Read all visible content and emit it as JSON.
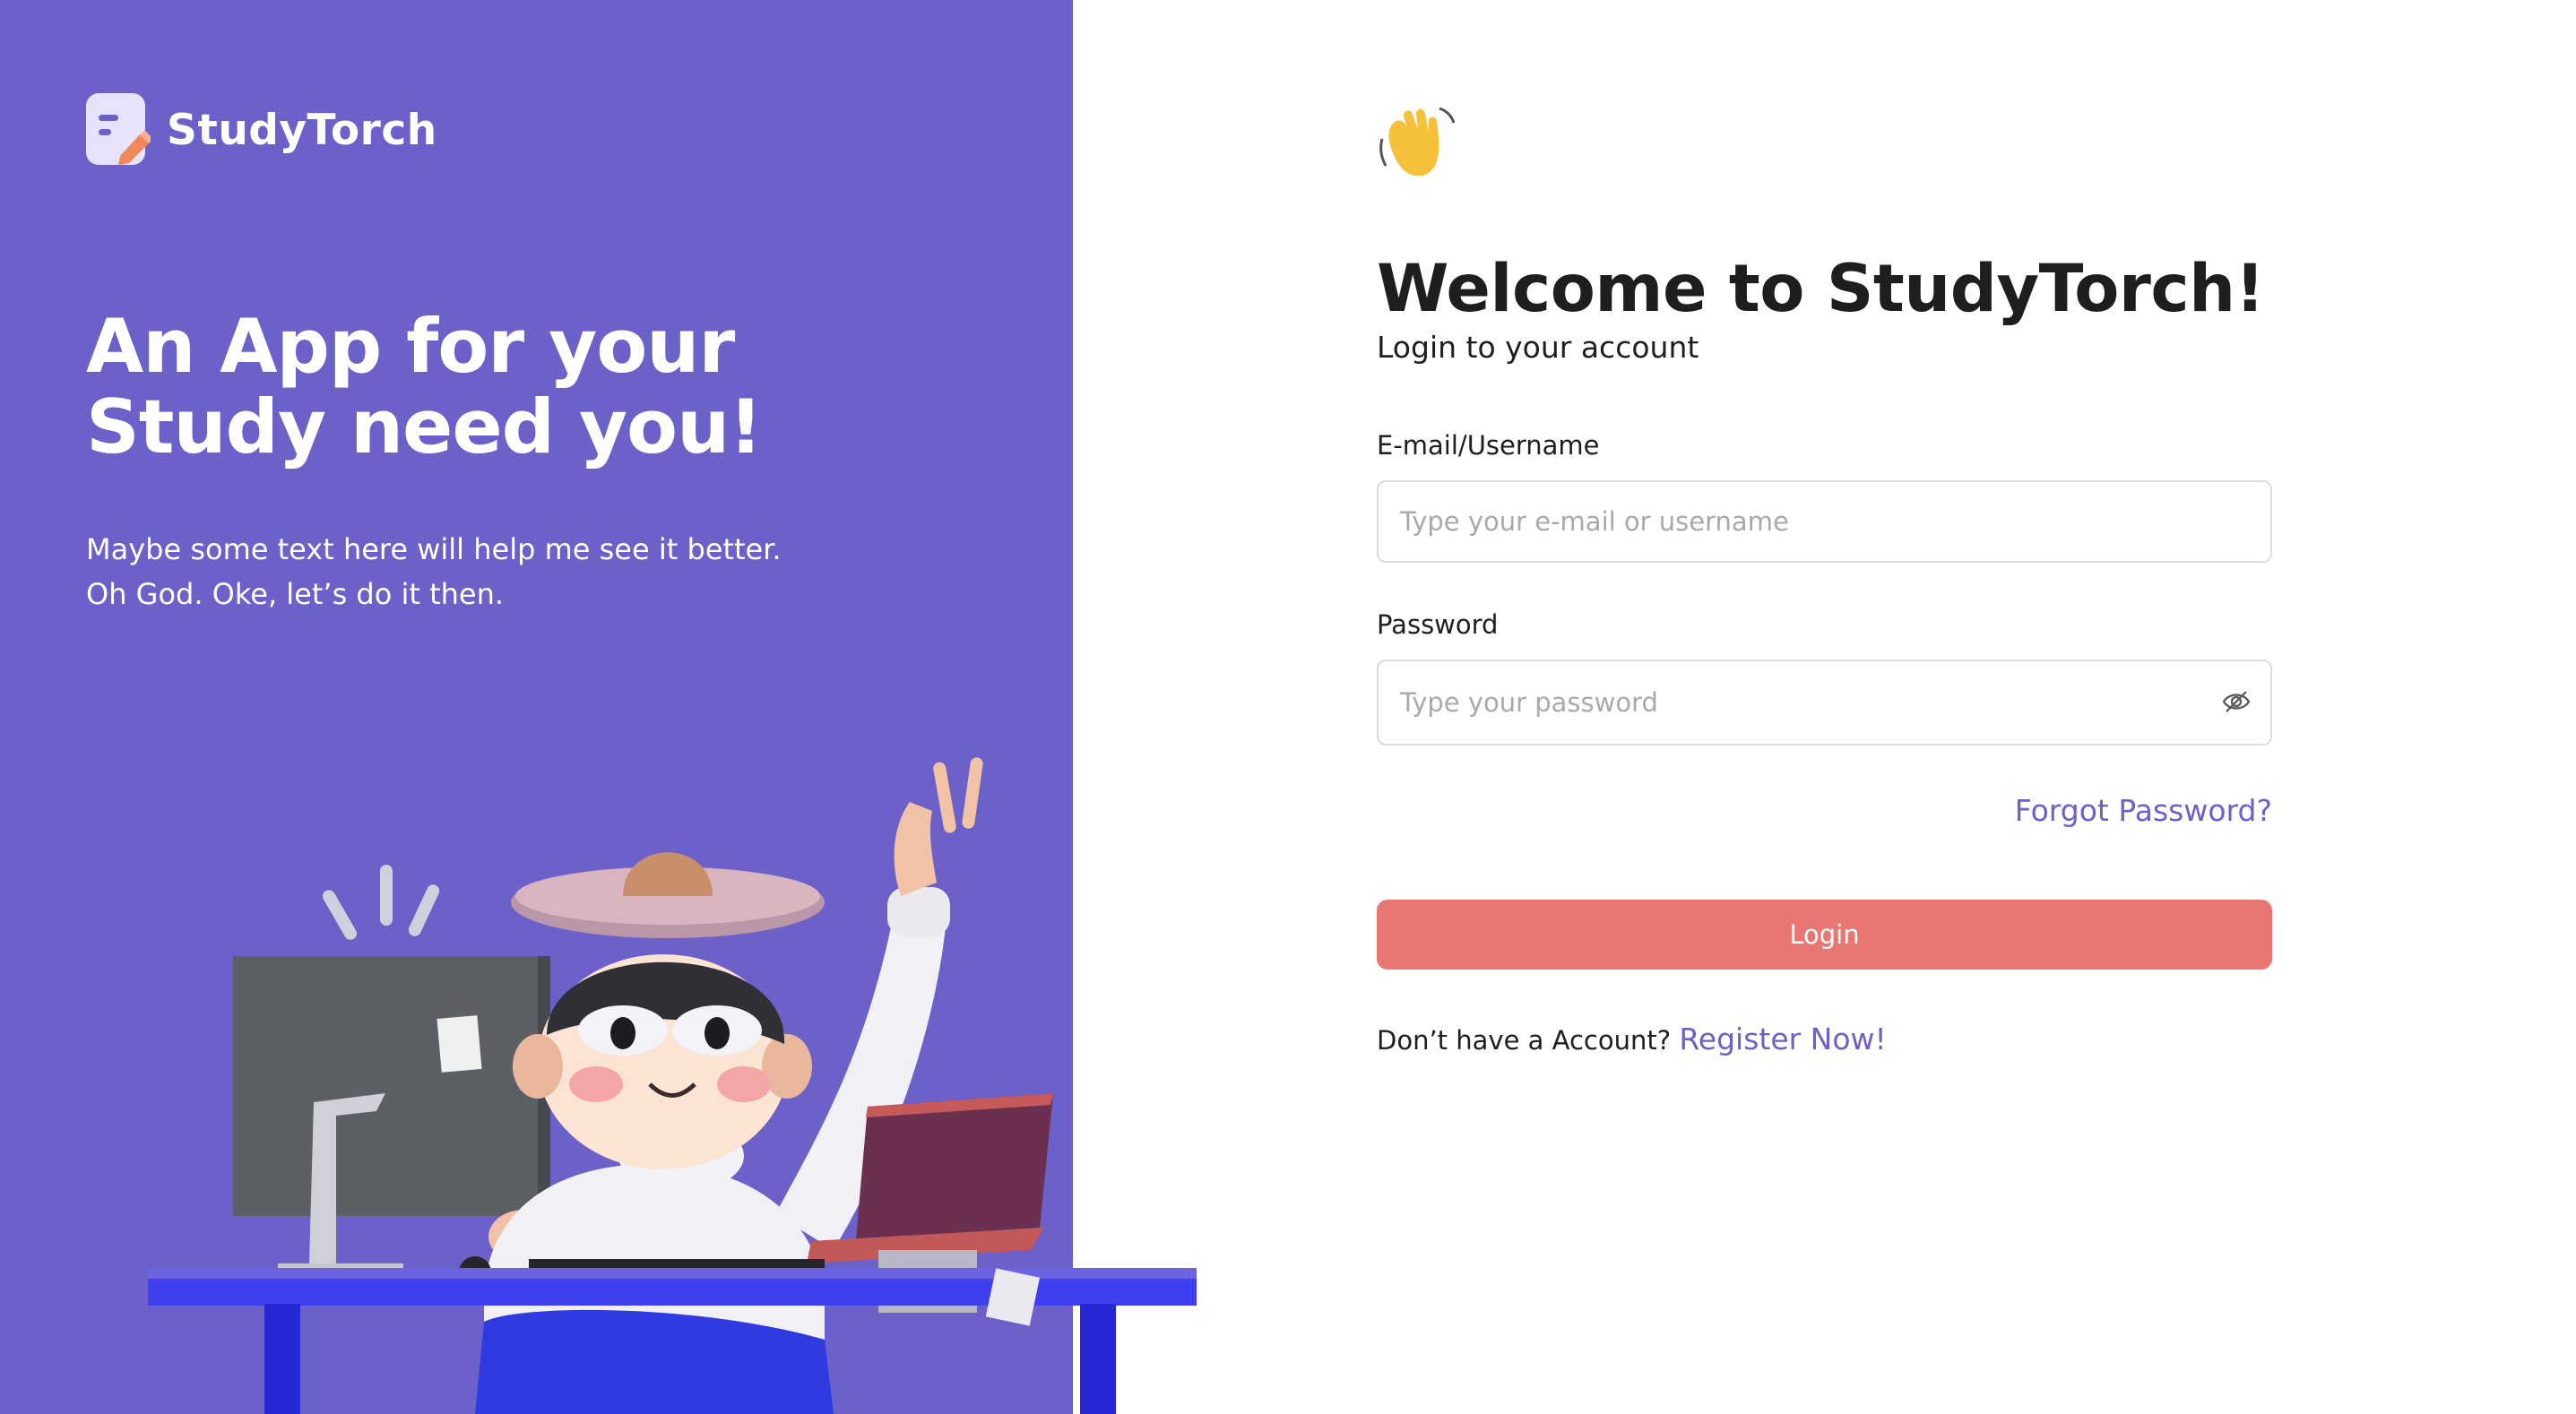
{
  "brand": {
    "name": "StudyTorch",
    "logo_icon": "document-pen-icon"
  },
  "hero": {
    "title_line1": "An App for your",
    "title_line2": "Study need you!",
    "subtitle_line1": "Maybe some text here will help me see it better.",
    "subtitle_line2": "Oh God. Oke, let’s do it then."
  },
  "login": {
    "wave_icon": "waving-hand-icon",
    "heading": "Welcome to StudyTorch!",
    "subheading": "Login to your account",
    "email_label": "E-mail/Username",
    "email_placeholder": "Type your e-mail or username",
    "email_value": "",
    "password_label": "Password",
    "password_placeholder": "Type your password",
    "password_value": "",
    "password_toggle_icon": "eye-slash-icon",
    "forgot_label": "Forgot Password?",
    "login_button": "Login",
    "no_account_text": "Don’t have a Account?",
    "register_label": "Register Now!"
  },
  "colors": {
    "primary": "#6c60c9",
    "login_button": "#e87672",
    "input_border": "#dcdcdc",
    "text": "#1e1e1e"
  }
}
